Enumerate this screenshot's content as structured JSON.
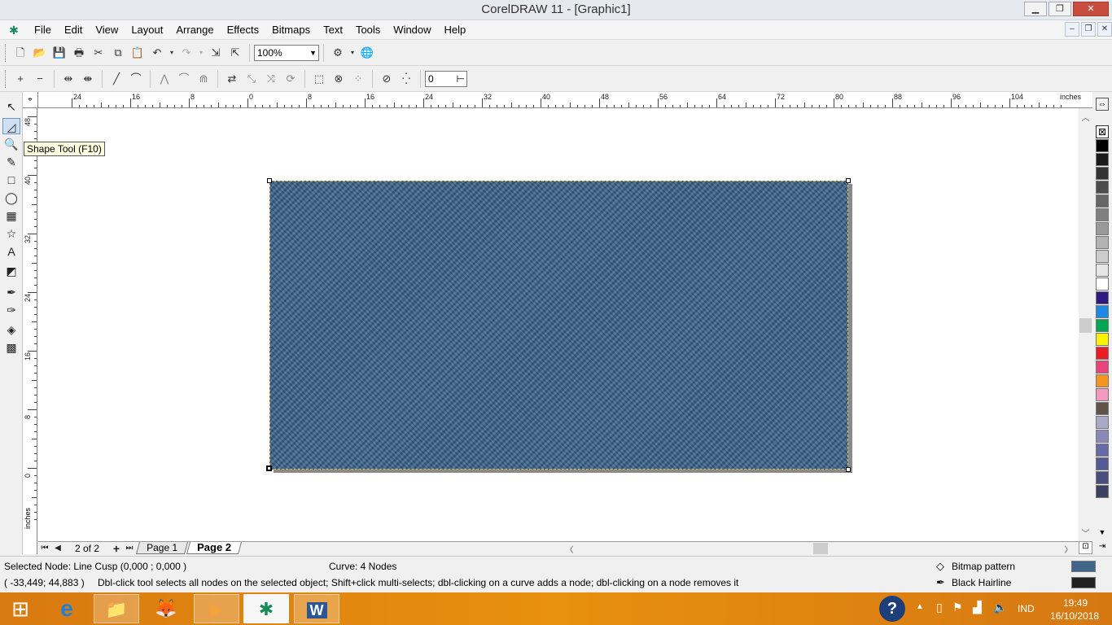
{
  "window": {
    "title": "CorelDRAW 11 - [Graphic1]",
    "minimize": "▁",
    "maximize": "❐",
    "close": "✕",
    "mdi_min": "‒",
    "mdi_restore": "❐",
    "mdi_close": "✕"
  },
  "menu": {
    "items": [
      "File",
      "Edit",
      "View",
      "Layout",
      "Arrange",
      "Effects",
      "Bitmaps",
      "Text",
      "Tools",
      "Window",
      "Help"
    ]
  },
  "standard_toolbar": {
    "zoom": "100%",
    "icons": [
      "new-icon",
      "open-icon",
      "save-icon",
      "print-icon",
      "cut-icon",
      "copy-icon",
      "paste-icon",
      "undo-icon",
      "redo-icon",
      "import-icon",
      "export-icon",
      "app-launcher-icon",
      "corel-online-icon"
    ]
  },
  "property_bar": {
    "nodes_value": "0",
    "icons": [
      "add-node-icon",
      "delete-node-icon",
      "join-nodes-icon",
      "break-curve-icon",
      "to-line-icon",
      "to-curve-icon",
      "cusp-icon",
      "smooth-icon",
      "symmetrical-icon",
      "reverse-curve-icon",
      "extend-curve-icon",
      "extract-subpath-icon",
      "stretch-nodes-icon",
      "rotate-nodes-icon",
      "align-nodes-icon",
      "elastic-mode-icon",
      "select-all-nodes-icon",
      "reduce-nodes-icon"
    ]
  },
  "rulers": {
    "unit": "inches",
    "h_ticks": [
      "24",
      "16",
      "8",
      "0",
      "8",
      "16",
      "24",
      "32",
      "40",
      "48",
      "56",
      "64",
      "72",
      "80",
      "88",
      "96",
      "104"
    ],
    "v_ticks": [
      "48",
      "40",
      "32",
      "24",
      "16",
      "8",
      "0"
    ]
  },
  "toolbox": {
    "tools": [
      "pick-tool-icon",
      "shape-tool-icon",
      "zoom-tool-icon",
      "freehand-tool-icon",
      "rectangle-tool-icon",
      "ellipse-tool-icon",
      "graph-paper-tool-icon",
      "basic-shapes-tool-icon",
      "text-tool-icon",
      "interactive-blend-tool-icon",
      "eyedropper-tool-icon",
      "outline-tool-icon",
      "fill-tool-icon",
      "interactive-fill-tool-icon"
    ],
    "tooltip": "Shape Tool (F10)"
  },
  "pages": {
    "count_label": "2 of 2",
    "tabs": [
      "Page 1",
      "Page 2"
    ],
    "active": "Page 2"
  },
  "palette": {
    "colors": [
      "#000000",
      "#1a1a1a",
      "#333333",
      "#4d4d4d",
      "#666666",
      "#808080",
      "#999999",
      "#b3b3b3",
      "#cccccc",
      "#e6e6e6",
      "#ffffff",
      "#2e1a80",
      "#1e88e5",
      "#00a651",
      "#fff200",
      "#ed1c24",
      "#e8437a",
      "#f7941d",
      "#f49ac1",
      "#605448",
      "#a9a9c9",
      "#8a88b8",
      "#6a69a8",
      "#555a95",
      "#484d7e",
      "#3c4162"
    ]
  },
  "status": {
    "selected_node": "Selected Node: Line Cusp (0,000 ; 0,000 )",
    "curve": "Curve: 4 Nodes",
    "coordinates": "( -33,449; 44,883 )",
    "hint": "Dbl-click tool selects all nodes on the selected object; Shift+click multi-selects; dbl-clicking on a curve adds a node; dbl-clicking on a node removes it",
    "fill_label": "Bitmap pattern",
    "outline_label": "Black  Hairline",
    "outline_color": "#222222",
    "fill_color": "#3f6688"
  },
  "taskbar": {
    "apps": [
      "start-icon",
      "internet-explorer-icon",
      "file-explorer-icon",
      "firefox-icon",
      "media-player-icon",
      "coreldraw-icon",
      "word-icon"
    ],
    "language": "IND",
    "time": "19:49",
    "date": "16/10/2018"
  }
}
